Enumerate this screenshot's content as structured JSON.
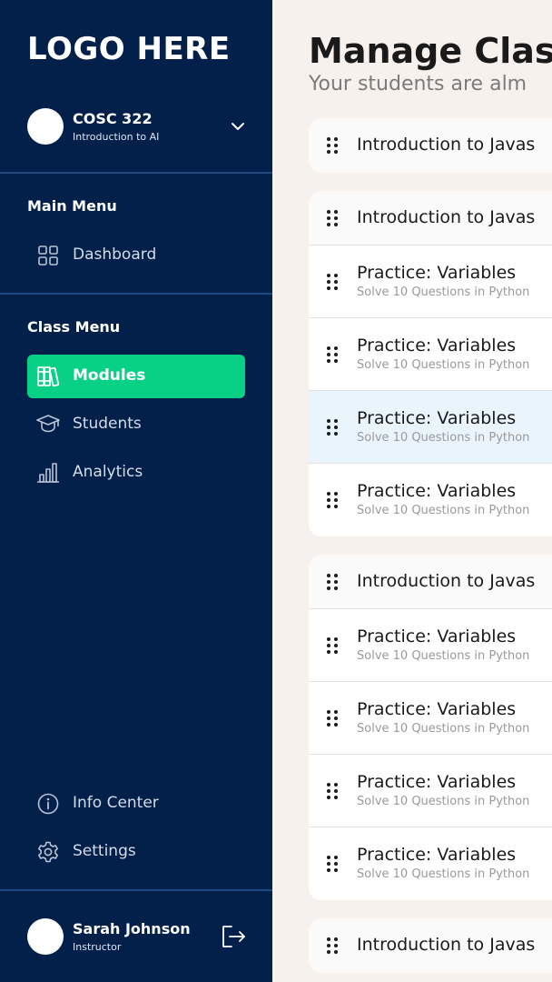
{
  "sidebar": {
    "logo": "LOGO HERE",
    "course": {
      "code": "COSC 322",
      "name": "Introduction to AI"
    },
    "main_menu": {
      "label": "Main Menu",
      "items": [
        {
          "label": "Dashboard",
          "icon": "dashboard-icon"
        }
      ]
    },
    "class_menu": {
      "label": "Class Menu",
      "items": [
        {
          "label": "Modules",
          "icon": "books-icon",
          "active": true
        },
        {
          "label": "Students",
          "icon": "graduation-cap-icon"
        },
        {
          "label": "Analytics",
          "icon": "bar-chart-icon"
        }
      ]
    },
    "footer_menu": [
      {
        "label": "Info Center",
        "icon": "info-icon"
      },
      {
        "label": "Settings",
        "icon": "gear-icon"
      }
    ],
    "user": {
      "name": "Sarah Johnson",
      "role": "Instructor"
    }
  },
  "main": {
    "title": "Manage Clas",
    "subtitle": "Your students are alm",
    "groups": [
      {
        "header": "Introduction to Javas",
        "items": []
      },
      {
        "header": "Introduction to Javas",
        "items": [
          {
            "title": "Practice: Variables",
            "sub": "Solve 10 Questions in Python"
          },
          {
            "title": "Practice: Variables",
            "sub": "Solve 10 Questions in Python"
          },
          {
            "title": "Practice: Variables",
            "sub": "Solve 10 Questions in Python",
            "highlighted": true
          },
          {
            "title": "Practice: Variables",
            "sub": "Solve 10 Questions in Python"
          }
        ]
      },
      {
        "header": "Introduction to Javas",
        "items": [
          {
            "title": "Practice: Variables",
            "sub": "Solve 10 Questions in Python"
          },
          {
            "title": "Practice: Variables",
            "sub": "Solve 10 Questions in Python"
          },
          {
            "title": "Practice: Variables",
            "sub": "Solve 10 Questions in Python"
          },
          {
            "title": "Practice: Variables",
            "sub": "Solve 10 Questions in Python"
          }
        ]
      },
      {
        "header": "Introduction to Javas",
        "items": []
      }
    ]
  },
  "colors": {
    "sidebar_bg": "#02204a",
    "accent": "#08d185",
    "main_bg": "#f6f1ec",
    "highlight_row": "#eaf4fc"
  }
}
